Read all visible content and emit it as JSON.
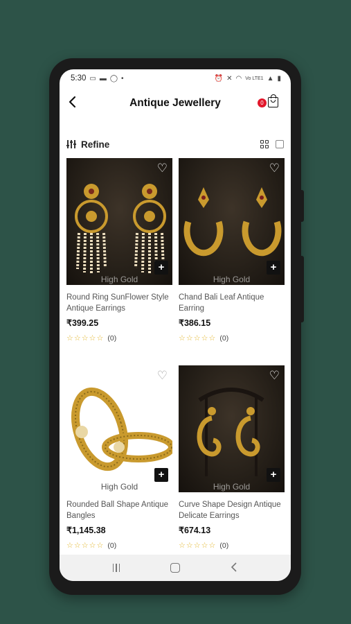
{
  "status_bar": {
    "time": "5:30",
    "dot": "•",
    "network_label": "Vo LTE1"
  },
  "header": {
    "title": "Antique Jewellery",
    "cart_count": "0"
  },
  "toolbar": {
    "refine_label": "Refine"
  },
  "products": [
    {
      "name": "Round Ring SunFlower Style Antique Earrings",
      "price": "₹399.25",
      "rating_count": "(0)",
      "brand_watermark": "High Gold"
    },
    {
      "name": "Chand Bali Leaf Antique Earring",
      "price": "₹386.15",
      "rating_count": "(0)",
      "brand_watermark": "High Gold"
    },
    {
      "name": "Rounded Ball Shape Antique Bangles",
      "price": "₹1,145.38",
      "rating_count": "(0)",
      "brand_watermark": "High Gold"
    },
    {
      "name": "Curve Shape Design Antique Delicate Earrings",
      "price": "₹674.13",
      "rating_count": "(0)",
      "brand_watermark": "High Gold"
    }
  ],
  "colors": {
    "background": "#2d5348",
    "badge": "#e2172b",
    "star": "#e2b52a",
    "gold": "#c99a2e"
  },
  "icons": [
    "back-arrow-icon",
    "cart-icon",
    "refine-icon",
    "grid-view-icon",
    "list-view-icon",
    "heart-icon",
    "plus-icon",
    "star-icon"
  ]
}
